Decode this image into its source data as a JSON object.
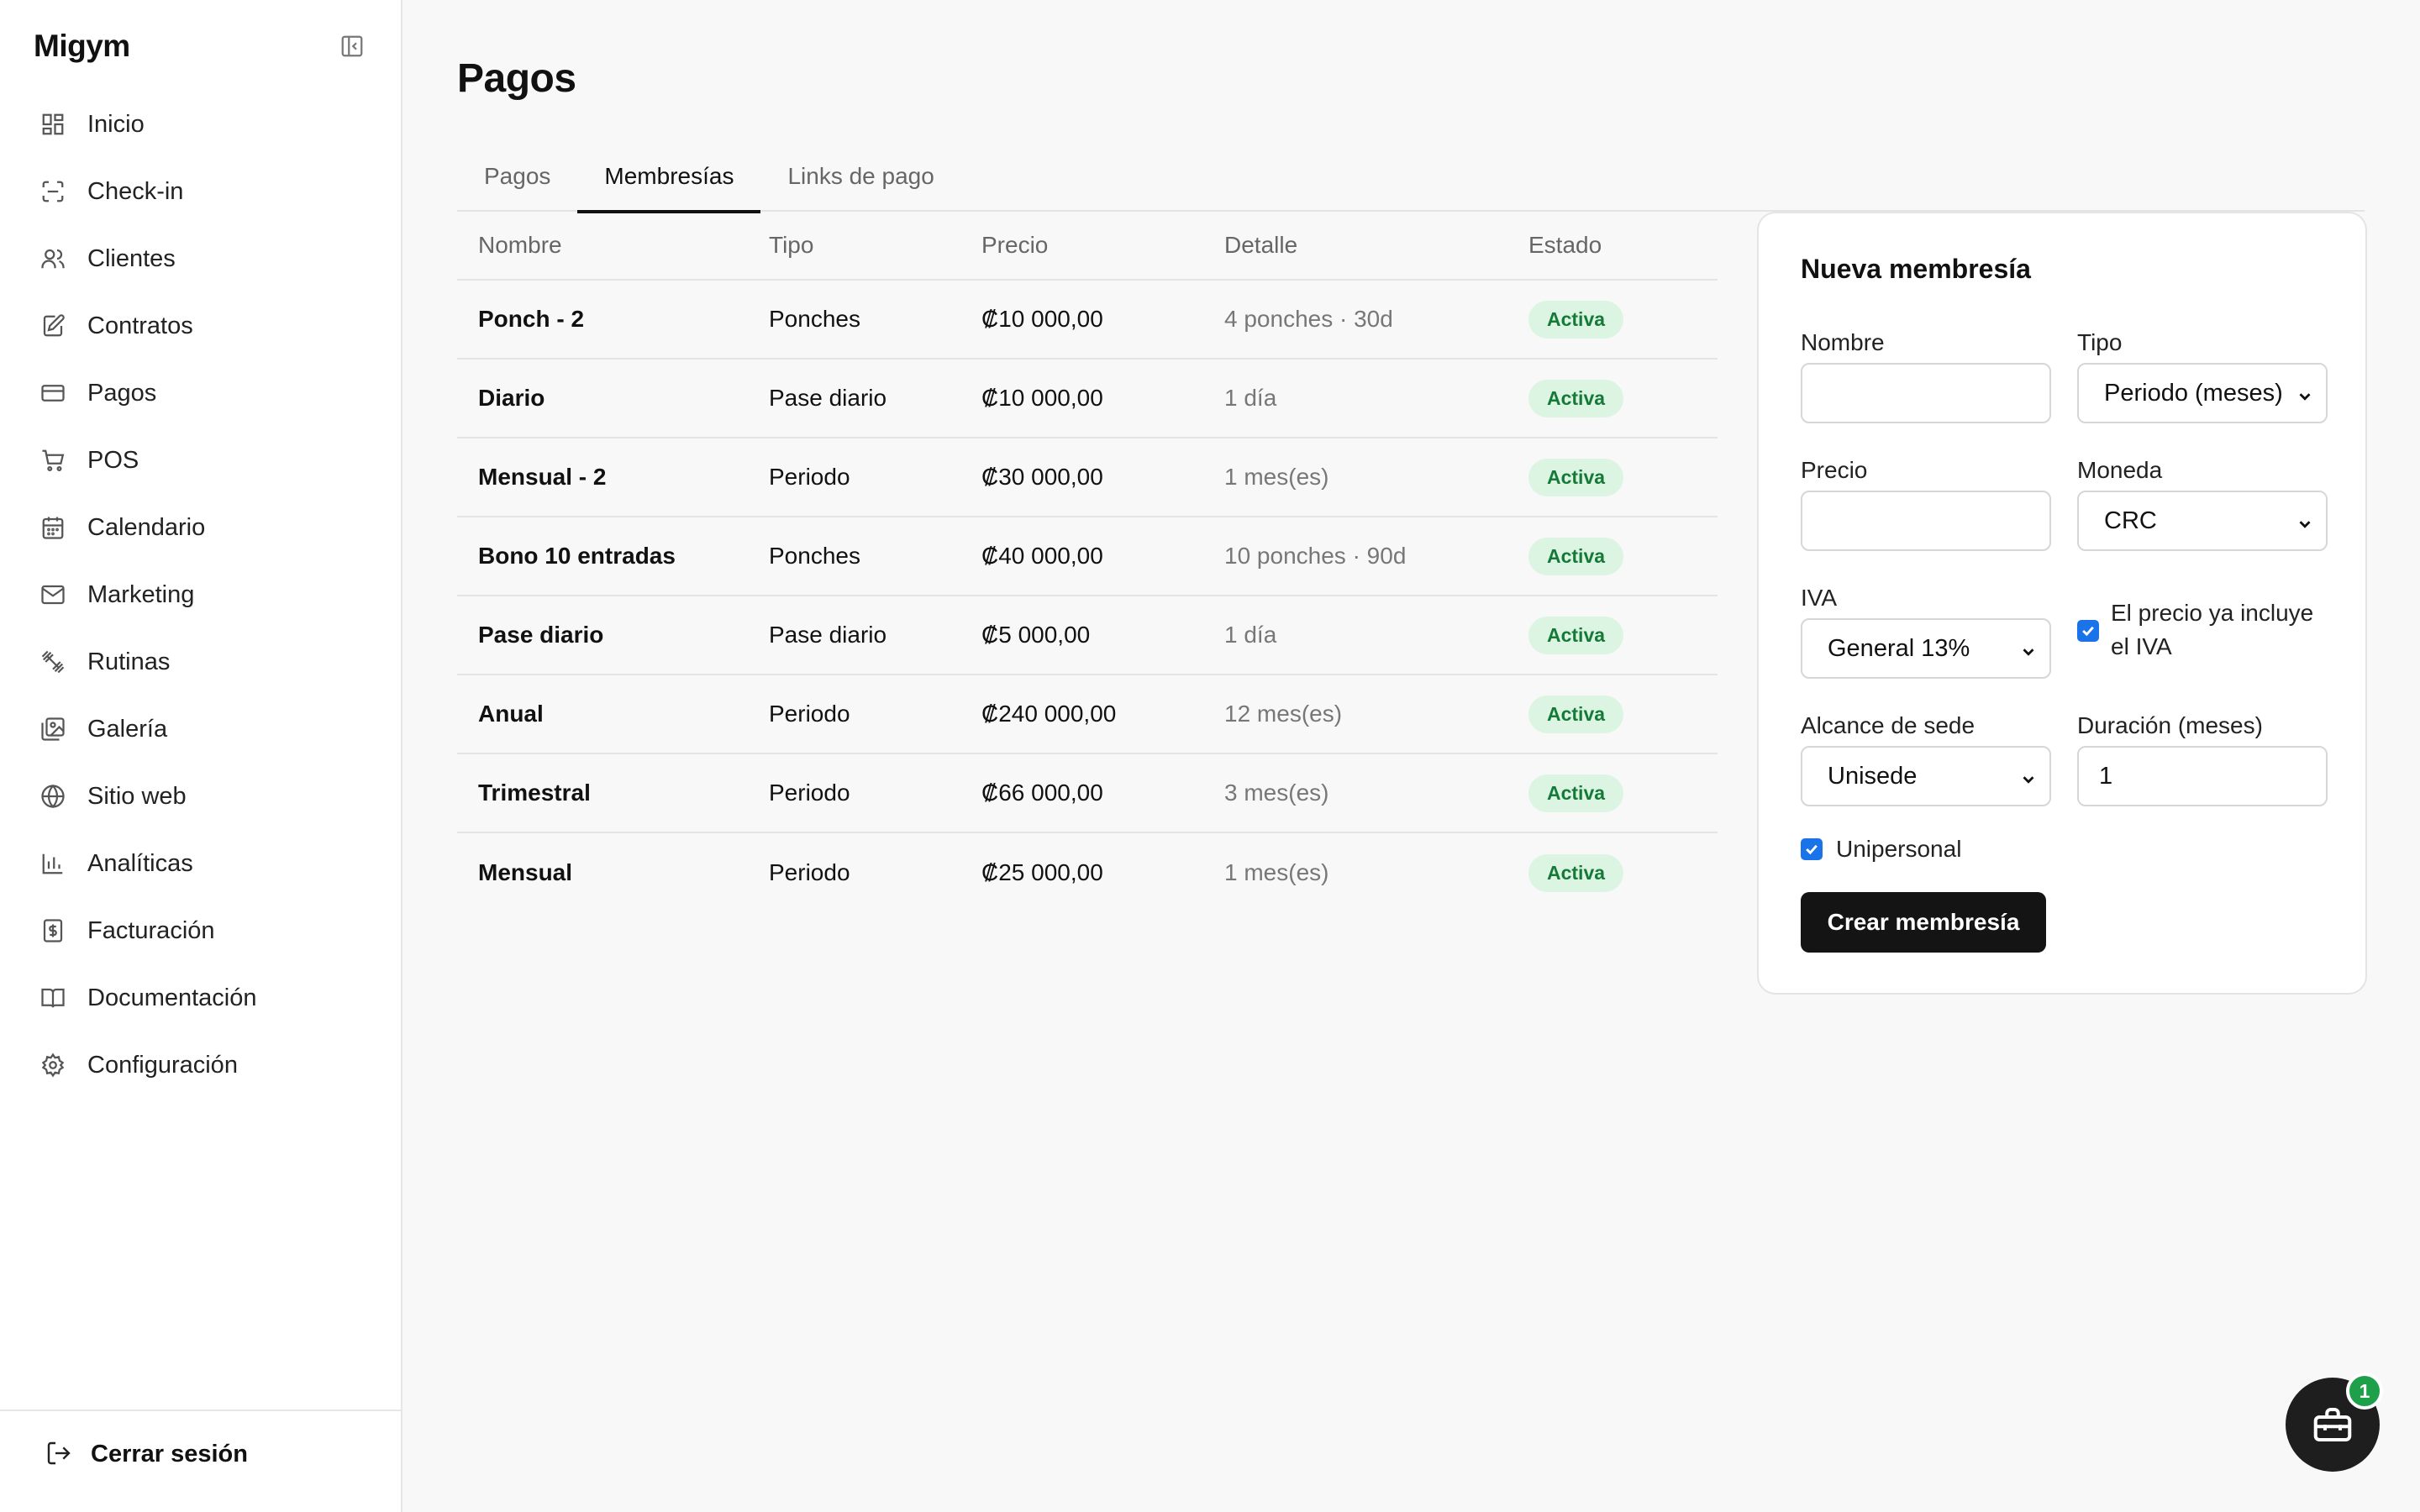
{
  "app": {
    "brand": "Migym"
  },
  "sidebar": {
    "items": [
      {
        "label": "Inicio",
        "icon": "dashboard-icon"
      },
      {
        "label": "Check-in",
        "icon": "scan-icon"
      },
      {
        "label": "Clientes",
        "icon": "users-icon"
      },
      {
        "label": "Contratos",
        "icon": "contract-icon"
      },
      {
        "label": "Pagos",
        "icon": "credit-card-icon"
      },
      {
        "label": "POS",
        "icon": "cart-icon"
      },
      {
        "label": "Calendario",
        "icon": "calendar-icon"
      },
      {
        "label": "Marketing",
        "icon": "mail-icon"
      },
      {
        "label": "Rutinas",
        "icon": "dumbbell-icon"
      },
      {
        "label": "Galería",
        "icon": "gallery-icon"
      },
      {
        "label": "Sitio web",
        "icon": "globe-icon"
      },
      {
        "label": "Analíticas",
        "icon": "bar-chart-icon"
      },
      {
        "label": "Facturación",
        "icon": "invoice-icon"
      },
      {
        "label": "Documentación",
        "icon": "book-icon"
      },
      {
        "label": "Configuración",
        "icon": "settings-icon"
      }
    ],
    "logout": "Cerrar sesión"
  },
  "main": {
    "title": "Pagos",
    "tabs": [
      {
        "label": "Pagos",
        "active": false
      },
      {
        "label": "Membresías",
        "active": true
      },
      {
        "label": "Links de pago",
        "active": false
      }
    ],
    "table": {
      "headers": [
        "Nombre",
        "Tipo",
        "Precio",
        "Detalle",
        "Estado"
      ],
      "rows": [
        {
          "name": "Ponch - 2",
          "type": "Ponches",
          "price": "₡10 000,00",
          "detail": "4 ponches · 30d",
          "status": "Activa"
        },
        {
          "name": "Diario",
          "type": "Pase diario",
          "price": "₡10 000,00",
          "detail": "1 día",
          "status": "Activa"
        },
        {
          "name": "Mensual - 2",
          "type": "Periodo",
          "price": "₡30 000,00",
          "detail": "1 mes(es)",
          "status": "Activa"
        },
        {
          "name": "Bono 10 entradas",
          "type": "Ponches",
          "price": "₡40 000,00",
          "detail": "10 ponches · 90d",
          "status": "Activa"
        },
        {
          "name": "Pase diario",
          "type": "Pase diario",
          "price": "₡5 000,00",
          "detail": "1 día",
          "status": "Activa"
        },
        {
          "name": "Anual",
          "type": "Periodo",
          "price": "₡240 000,00",
          "detail": "12 mes(es)",
          "status": "Activa"
        },
        {
          "name": "Trimestral",
          "type": "Periodo",
          "price": "₡66 000,00",
          "detail": "3 mes(es)",
          "status": "Activa"
        },
        {
          "name": "Mensual",
          "type": "Periodo",
          "price": "₡25 000,00",
          "detail": "1 mes(es)",
          "status": "Activa"
        }
      ]
    }
  },
  "form": {
    "title": "Nueva membresía",
    "nombre_label": "Nombre",
    "nombre_value": "",
    "tipo_label": "Tipo",
    "tipo_value": "Periodo (meses)",
    "precio_label": "Precio",
    "precio_value": "",
    "moneda_label": "Moneda",
    "moneda_value": "CRC",
    "iva_label": "IVA",
    "iva_value": "General 13%",
    "iva_incluido_label_1": "El precio ya incluye",
    "iva_incluido_label_2": "el IVA",
    "iva_incluido_checked": true,
    "alcance_label": "Alcance de sede",
    "alcance_value": "Unisede",
    "duracion_label": "Duración (meses)",
    "duracion_value": "1",
    "unipersonal_label": "Unipersonal",
    "unipersonal_checked": true,
    "submit_label": "Crear membresía"
  },
  "fab": {
    "badge_count": "1",
    "icon": "toolbox-icon"
  },
  "colors": {
    "accent": "#141414",
    "status_bg": "#dcf5e3",
    "status_text": "#157a37",
    "checkbox": "#1a73e8",
    "notification": "#1ea04b"
  }
}
